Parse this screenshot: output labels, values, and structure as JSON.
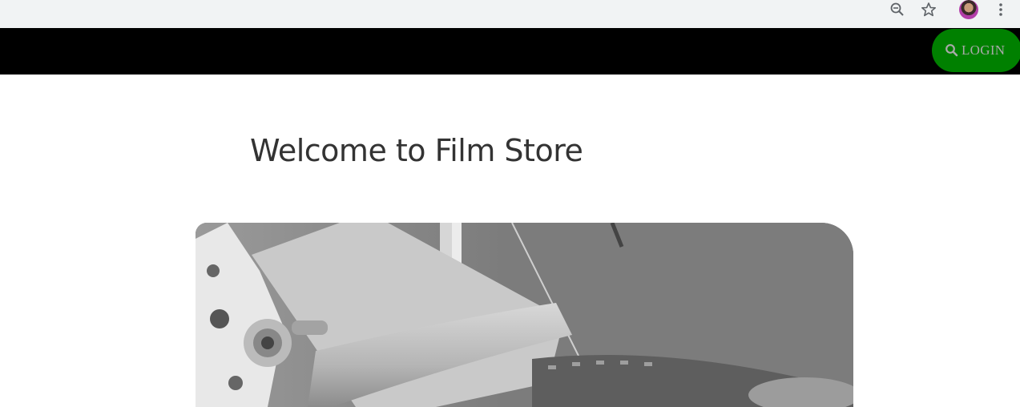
{
  "browser": {
    "icons": [
      "zoom-out-icon",
      "star-icon",
      "profile-avatar",
      "more-menu-icon"
    ]
  },
  "navbar": {
    "background": "#000000",
    "login_label": "LOGIN",
    "login_icon": "search-icon",
    "login_color": "#008000"
  },
  "main": {
    "title": "Welcome to Film Store",
    "hero_image": "film-projector-reel-photo"
  }
}
